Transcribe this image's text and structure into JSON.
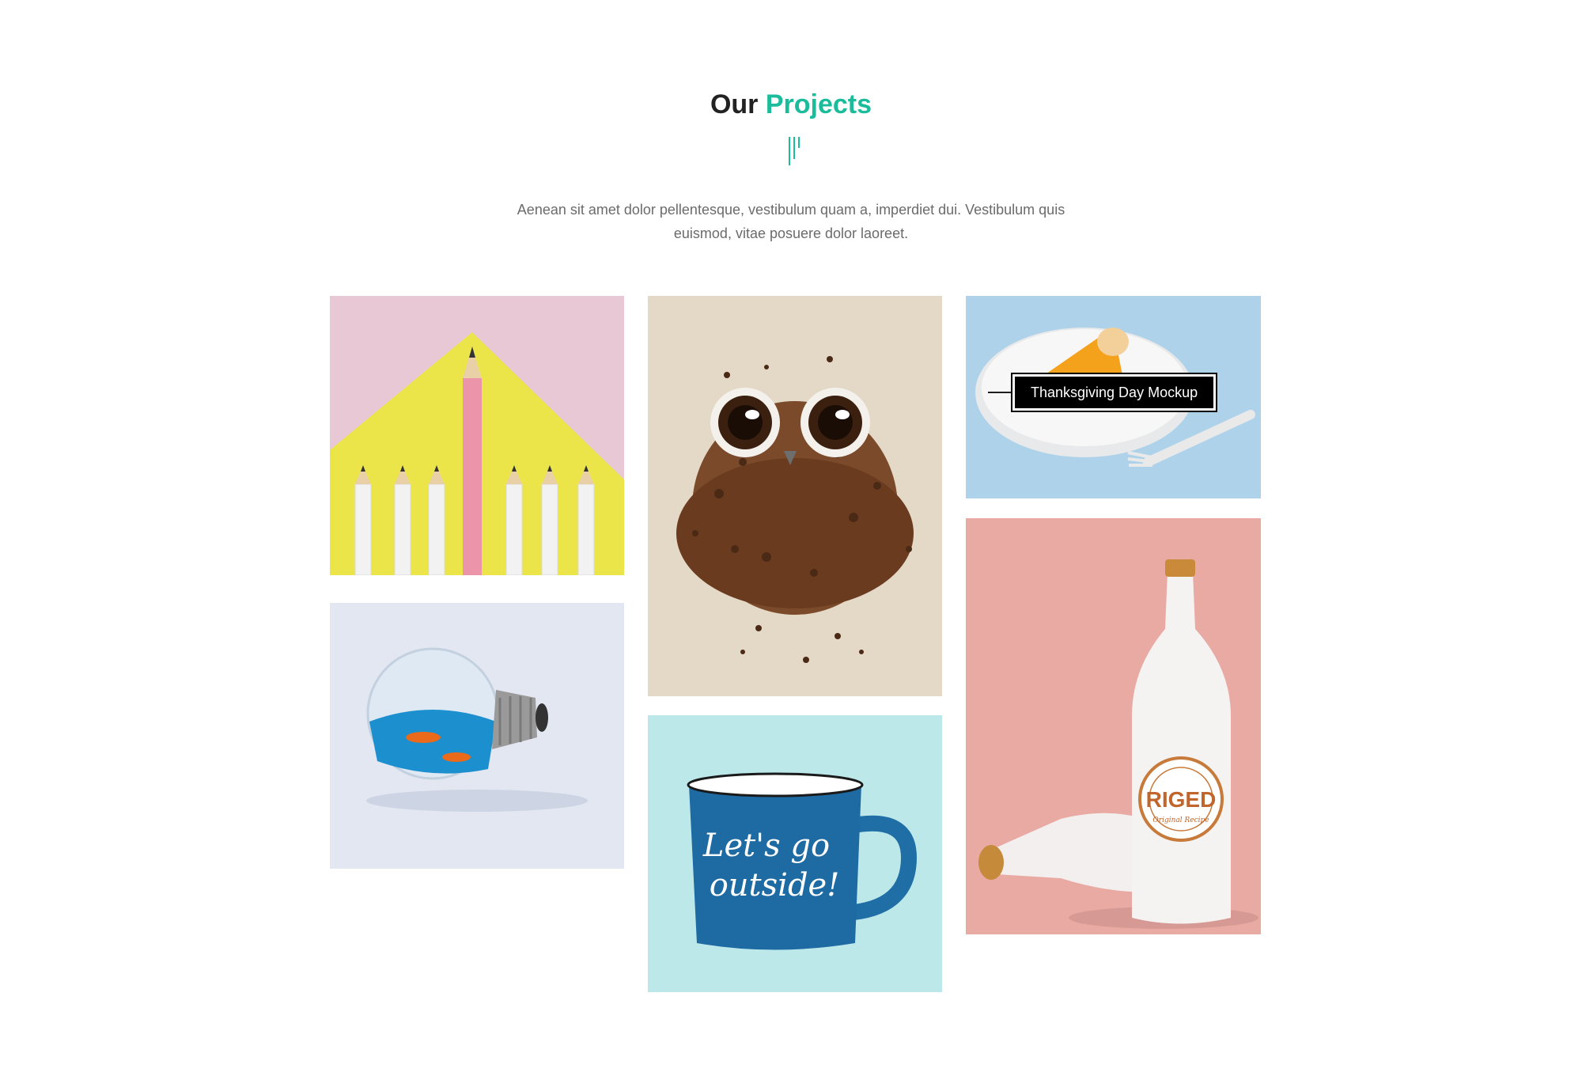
{
  "section": {
    "title_prefix": "Our",
    "title_accent": "Projects",
    "description": "Aenean sit amet dolor pellentesque, vestibulum quam a, imperdiet dui. Vestibulum quis euismod, vitae posuere dolor laoreet.",
    "accent_color": "#1abc9c"
  },
  "projects": [
    {
      "icon": "pencils-image"
    },
    {
      "icon": "coffee-owl-image"
    },
    {
      "icon": "pie-plate-image",
      "hover_label": "Thanksgiving Day Mockup"
    },
    {
      "icon": "lightbulb-fish-image"
    },
    {
      "icon": "mug-image",
      "mug_text": [
        "Let's go",
        "outside!"
      ]
    },
    {
      "icon": "bottles-image",
      "label_text": "RIGED",
      "label_sub": "Original Recipe"
    }
  ]
}
